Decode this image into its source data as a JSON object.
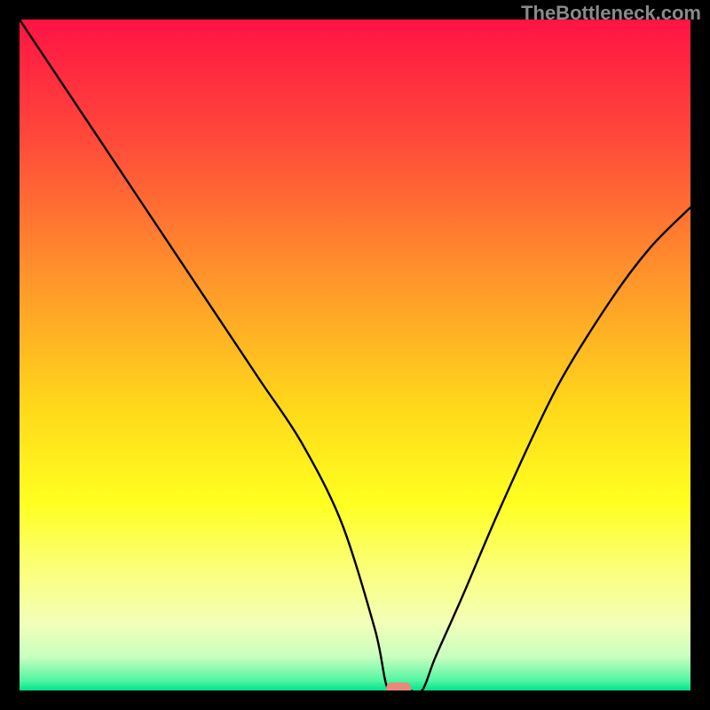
{
  "watermark": "TheBottleneck.com",
  "chart_data": {
    "type": "line",
    "title": "",
    "xlabel": "",
    "ylabel": "",
    "xlim": [
      0,
      100
    ],
    "ylim": [
      0,
      100
    ],
    "grid": false,
    "series": [
      {
        "name": "bottleneck-curve",
        "x": [
          0,
          6,
          12,
          18,
          24,
          30,
          36,
          42,
          48,
          53,
          55,
          58,
          60,
          62,
          66,
          72,
          80,
          88,
          94,
          100
        ],
        "y": [
          100,
          91,
          82,
          73,
          64,
          55,
          46,
          37,
          25,
          9,
          0,
          0,
          0,
          5,
          14,
          28,
          45,
          58,
          66,
          72
        ]
      }
    ],
    "marker": {
      "x": 56.5,
      "y": 0,
      "color": "#e8897b",
      "shape": "rounded-rect"
    },
    "background_gradient": {
      "type": "vertical",
      "stops": [
        {
          "offset": 0.0,
          "color": "#ff1344"
        },
        {
          "offset": 0.18,
          "color": "#ff4a3a"
        },
        {
          "offset": 0.4,
          "color": "#ff9a2a"
        },
        {
          "offset": 0.58,
          "color": "#ffd91a"
        },
        {
          "offset": 0.72,
          "color": "#ffff20"
        },
        {
          "offset": 0.82,
          "color": "#fbff7a"
        },
        {
          "offset": 0.9,
          "color": "#f2ffb8"
        },
        {
          "offset": 0.95,
          "color": "#c8ffbf"
        },
        {
          "offset": 0.985,
          "color": "#52f5a3"
        },
        {
          "offset": 1.0,
          "color": "#00e38a"
        }
      ]
    }
  }
}
